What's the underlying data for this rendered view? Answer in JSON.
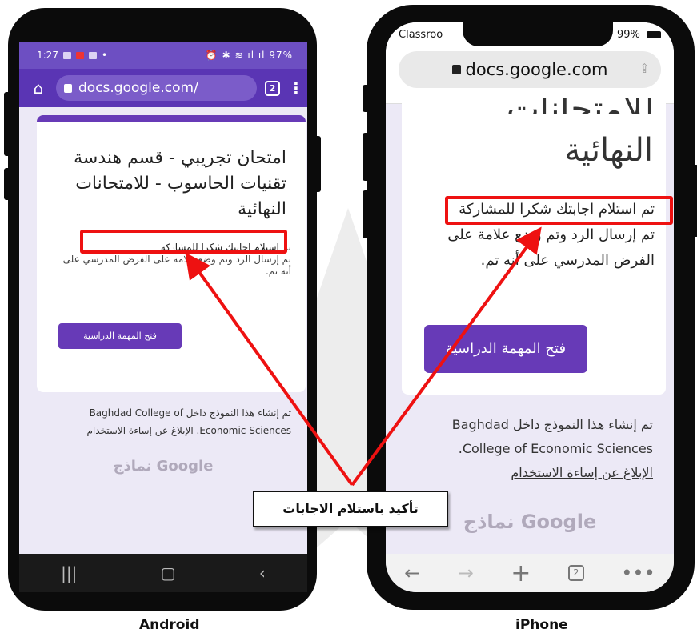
{
  "labels": {
    "android": "Android",
    "iphone": "iPhone"
  },
  "callout": "تأكيد باستلام الاجابات",
  "colors": {
    "accent": "#673ab7",
    "highlight": "#ee1111",
    "background": "#ece9f6"
  },
  "android": {
    "status_time": "1:27",
    "status_right": "97%",
    "url": "docs.google.com/",
    "tab_count": "2",
    "title": "امتحان تجريبي - قسم هندسة تقنيات الحاسوب - للامتحانات النهائية",
    "confirmation": "تم استلام اجابتك شكرا للمشاركة",
    "response_line": "تم إرسال الرد وتم وضع علامة على الفرض المدرسي على أنه تم.",
    "button": "فتح المهمة الدراسية",
    "footer_line1": "تم إنشاء هذا النموذج داخل Baghdad College of",
    "footer_line2": "Economic Sciences.",
    "footer_link": "الإبلاغ عن إساءة الاستخدام",
    "forms_brand": "نماذج Google",
    "icons": [
      "home-icon",
      "lock-icon",
      "tabs-icon",
      "menu-icon",
      "recents-icon",
      "home-button-icon",
      "back-icon"
    ]
  },
  "iphone": {
    "carrier": "Classroo",
    "battery": "99%",
    "url": "docs.google.com",
    "title_partial": "للامتحانات",
    "title": "النهائية",
    "confirmation": "تم استلام اجابتك شكرا للمشاركة",
    "response_line": "تم إرسال الرد وتم وضع علامة على الفرض المدرسي على أنه تم.",
    "button": "فتح المهمة الدراسية",
    "footer_line1": "تم إنشاء هذا النموذج داخل Baghdad",
    "footer_line2": "College of Economic Sciences.",
    "footer_link": "الإبلاغ عن إساءة الاستخدام",
    "forms_brand": "نماذج Google",
    "tab_count": "2",
    "icons": [
      "lock-icon",
      "share-icon",
      "back-arrow-icon",
      "forward-arrow-icon",
      "new-tab-icon",
      "tabs-icon",
      "more-icon"
    ]
  }
}
